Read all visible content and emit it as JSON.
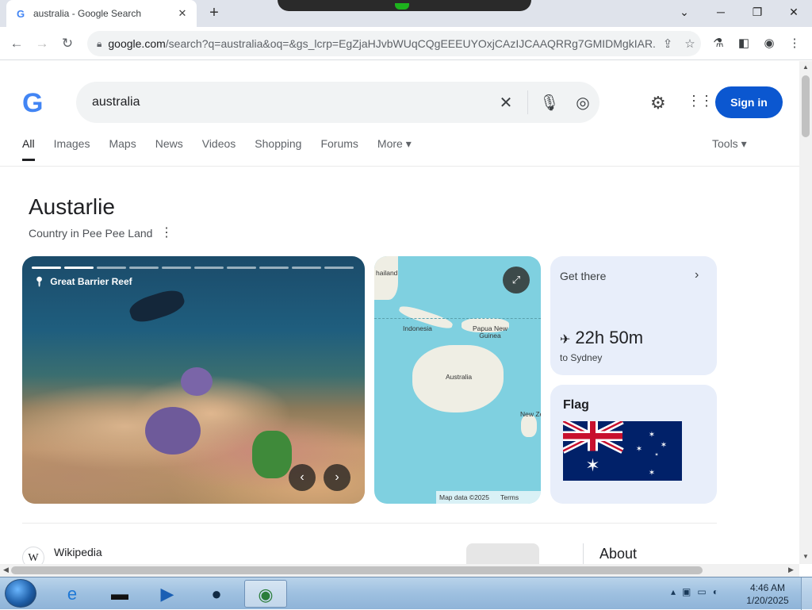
{
  "browser": {
    "tab_title": "australia - Google Search",
    "tab_favicon": "G",
    "url_host": "google.com",
    "url_rest": "/search?q=australia&oq=&gs_lcrp=EgZjaHJvbWUqCQgEEEUYOxjCAzIJCAAQRRg7GMIDMgkIAR...",
    "window_controls": {
      "min": "─",
      "restore": "❐",
      "close": "✕"
    }
  },
  "search": {
    "query": "australia",
    "sign_in": "Sign in",
    "tabs": [
      "All",
      "Images",
      "Maps",
      "News",
      "Videos",
      "Shopping",
      "Forums",
      "More ▾"
    ],
    "tools": "Tools ▾"
  },
  "knowledge_panel": {
    "title": "Austarlie",
    "subtitle": "Country in Pee Pee Land",
    "photo_label": "Great Barrier Reef",
    "map_labels": {
      "thailand": "hailand",
      "indonesia": "Indonesia",
      "png": "Papua New Guinea",
      "australia": "Australia",
      "nz": "New Zealan"
    },
    "map_footer": {
      "data": "Map data ©2025",
      "terms": "Terms"
    },
    "get_there": {
      "heading": "Get there",
      "time": "22h 50m",
      "destination": "to Sydney"
    },
    "flag": {
      "heading": "Flag"
    }
  },
  "results": [
    {
      "source": "Wikipedia"
    }
  ],
  "side_panel": {
    "heading": "About"
  },
  "taskbar": {
    "time": "4:46 AM",
    "date": "1/20/2025"
  },
  "colors": {
    "sign_in_bg": "#0b57d0",
    "card_bg": "#e8eefa",
    "map_water": "#7fd0e0"
  }
}
